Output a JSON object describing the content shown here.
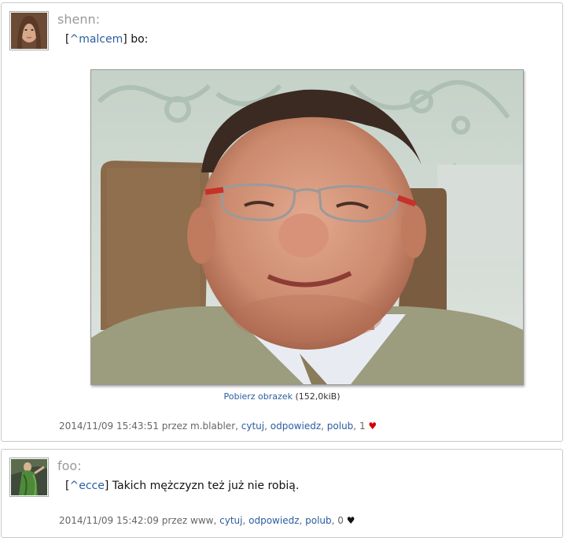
{
  "posts": [
    {
      "author": "shenn:",
      "reply_link": "^malcem",
      "message": "bo:",
      "download": {
        "link": "Pobierz obrazek",
        "size": "(152,0kiB)"
      },
      "meta": {
        "timestamp": "2014/11/09 15:43:51",
        "by_text": "przez m.blabler,",
        "quote": "cytuj",
        "reply": "odpowiedz",
        "like": "polub",
        "likes": "1",
        "heart": "♥",
        "heart_color": "#d40000"
      }
    },
    {
      "author": "foo:",
      "reply_link": "^ecce",
      "message": "Takich mężczyzn też już nie robią.",
      "meta": {
        "timestamp": "2014/11/09 15:42:09",
        "by_text": "przez www,",
        "quote": "cytuj",
        "reply": "odpowiedz",
        "like": "polub",
        "likes": "0",
        "heart": "♥",
        "heart_color": "#111111"
      }
    }
  ]
}
